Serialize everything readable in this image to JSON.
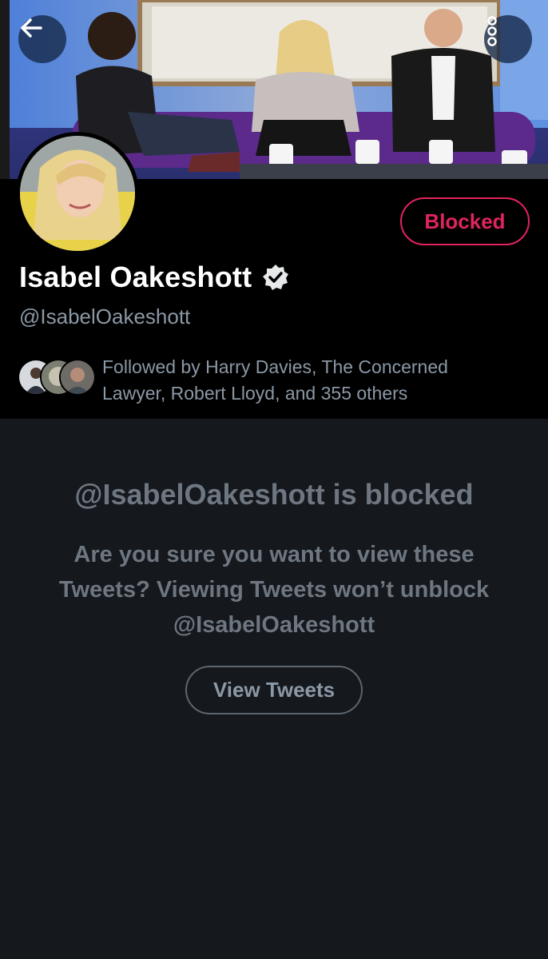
{
  "header": {
    "back_icon": "arrow-left-icon",
    "more_icon": "more-vertical-icon",
    "banner_image": "tv-studio-panel-photo"
  },
  "profile": {
    "display_name": "Isabel Oakeshott",
    "verified_icon": "verified-badge-icon",
    "handle": "@IsabelOakeshott",
    "blocked_label": "Blocked",
    "blocked_color": "#e0245e",
    "followed_by": "Followed by Harry Davies, The Concerned Lawyer, Robert Lloyd, and 355 others"
  },
  "blocked_notice": {
    "title": "@IsabelOakeshott is blocked",
    "body": "Are you sure you want to view these Tweets? Viewing Tweets won’t unblock @IsabelOakeshott",
    "view_button_label": "View Tweets"
  },
  "colors": {
    "background": "#15181c",
    "header_background": "#000000",
    "primary_text": "#ffffff",
    "secondary_text": "#8b98a5",
    "muted_text": "#6e7781"
  }
}
